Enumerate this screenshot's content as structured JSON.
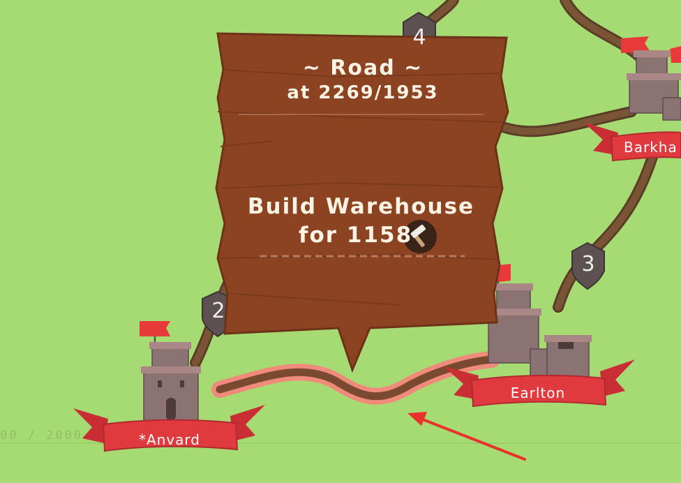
{
  "popup": {
    "title": "~ Road ~",
    "position_label": "at 2269/1953",
    "action_line1": "Build Warehouse",
    "action_line2_prefix": "for",
    "action_cost": "1158"
  },
  "castles": [
    {
      "name": "*Anvard"
    },
    {
      "name": "Earlton"
    },
    {
      "name": "Barkha"
    }
  ],
  "road_markers": [
    {
      "number": "4"
    },
    {
      "number": "2"
    },
    {
      "number": "3"
    }
  ],
  "hud": {
    "score_text": "00 / 2000"
  },
  "colors": {
    "grass": "#a6db74",
    "road": "#6b4a2e",
    "road_highlight": "#f08a7a",
    "sign_wood": "#8c4322",
    "banner_red": "#e03a3e",
    "arrow_red": "#e8322a"
  }
}
